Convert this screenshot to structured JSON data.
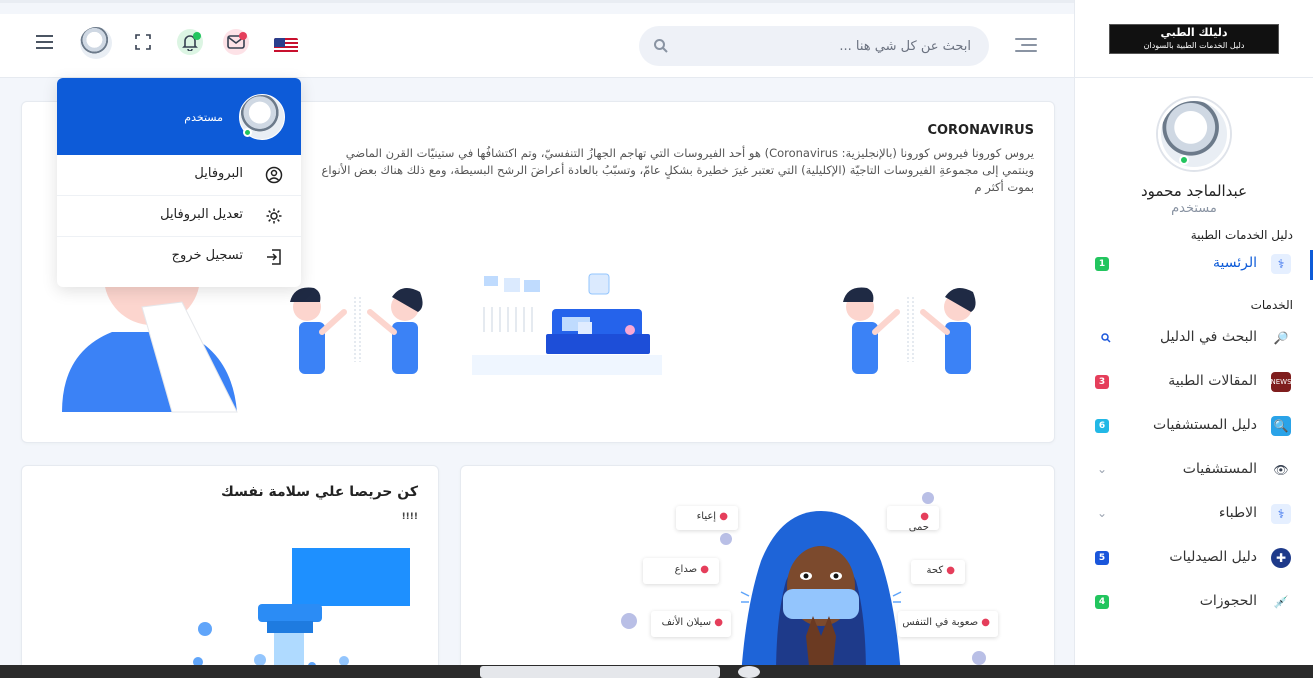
{
  "logo": {
    "line1": "دليلك الطبي",
    "line2": "دليل الخدمات الطبية بالسودان"
  },
  "profile": {
    "name": "عبدالماجد محمود",
    "role": "مستخدم"
  },
  "sidebar": {
    "section1": "دليل الخدمات الطبية",
    "section2": "الخدمات",
    "items": [
      {
        "label": "الرئسية",
        "badge": "1",
        "badge_color": "#22c55e",
        "icon": "doctor-icon",
        "active": true
      },
      {
        "label": "البحث في الدليل",
        "badge": "",
        "icon": "magnifier-icon"
      },
      {
        "label": "المقالات الطبية",
        "badge": "3",
        "badge_color": "#e53e5b",
        "icon": "news-icon"
      },
      {
        "label": "دليل المستشفيات",
        "badge": "6",
        "badge_color": "#22b8e6",
        "icon": "search-tile-icon"
      },
      {
        "label": "المستشفيات",
        "chevron": true,
        "icon": "eye-icon"
      },
      {
        "label": "الاطباء",
        "chevron": true,
        "icon": "doctor-icon"
      },
      {
        "label": "دليل الصيدليات",
        "badge": "5",
        "badge_color": "#1a56db",
        "icon": "pharmacy-icon"
      },
      {
        "label": "الحجوزات",
        "badge": "4",
        "badge_color": "#22c55e",
        "icon": "syringe-icon"
      }
    ]
  },
  "header": {
    "search_placeholder": "ابحث عن كل شي هنا ..."
  },
  "dropdown": {
    "role": "مستخدم",
    "items": [
      "البروفايل",
      "تعديل البروفايل",
      "تسجيل خروج"
    ]
  },
  "card1": {
    "title": "CORONAVIRUS",
    "line1": "يروس كورونا فيروس كورونا (بالإنجليزية: Coronavirus) هو أحد الفيروسات التي تهاجم الجهازُ التنفسيّ، وتم اكتشافُها في ستينيّات القرن الماضي",
    "line2": "وينتمي إلى مجموعةِ الفيروسات التاجيّة (الإكليلية) التي تعتبر غيرَ خطيرة بشكلٍ عامّ، وتسبّبُ بالعادة أعراضَ الرشح البسيطة، ومع ذلك هناك بعض الأنواع",
    "line3": "بموت أكثر م"
  },
  "card2": {
    "title": "كن حريصا علي سلامة نفسك",
    "sub": "!!!!"
  },
  "card3": {
    "symptoms": [
      "إعياء",
      "حمى",
      "صداع",
      "كحة",
      "سيلان الأنف",
      "صعوبة في التنفس"
    ]
  },
  "colors": {
    "primary": "#0d5bd8",
    "online": "#22c55e"
  }
}
